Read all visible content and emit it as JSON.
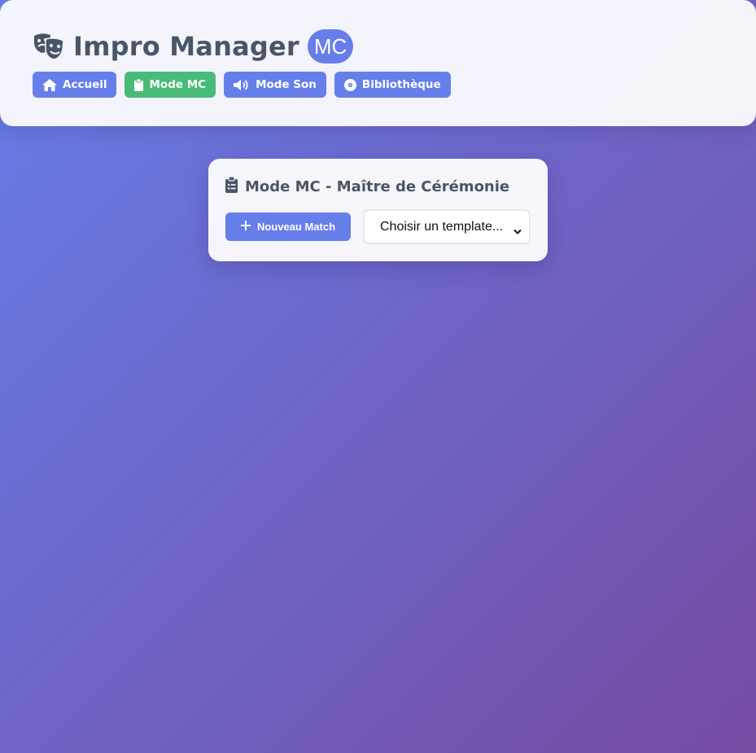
{
  "header": {
    "app_title": "Impro Manager",
    "mode_badge": "MC",
    "logo_icon": "theater-masks-icon",
    "nav": [
      {
        "label": "Accueil",
        "icon": "home-icon",
        "active": false
      },
      {
        "label": "Mode MC",
        "icon": "clipboard-icon",
        "active": true
      },
      {
        "label": "Mode Son",
        "icon": "volume-icon",
        "active": false
      },
      {
        "label": "Bibliothèque",
        "icon": "disc-icon",
        "active": false
      }
    ]
  },
  "mc_panel": {
    "title": "Mode MC - Maître de Cérémonie",
    "title_icon": "clipboard-list-icon",
    "new_match_label": "Nouveau Match",
    "new_match_icon": "plus-icon",
    "template_select": {
      "selected": "Choisir un template..."
    }
  },
  "colors": {
    "primary": "#667eea",
    "active": "#48bb78",
    "text": "#4a5568",
    "background_start": "#667eea",
    "background_end": "#764ba2"
  }
}
